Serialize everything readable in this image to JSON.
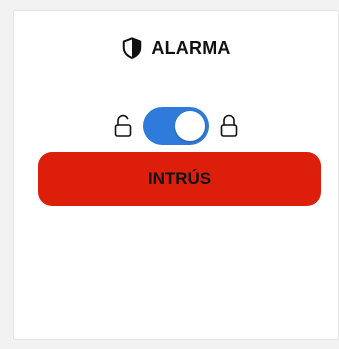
{
  "header": {
    "title": "ALARMA",
    "icon": "shield-icon"
  },
  "toggle": {
    "left_icon": "lock-open-icon",
    "right_icon": "lock-closed-icon",
    "state": "on",
    "color": "#2f7bdc"
  },
  "status": {
    "label": "INTRÚS",
    "color": "#dd1e0a"
  }
}
